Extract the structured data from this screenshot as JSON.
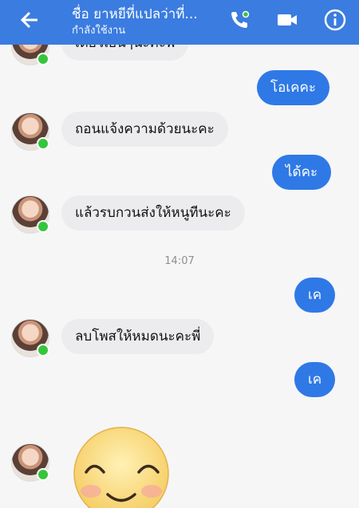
{
  "header": {
    "title": "ชื่อ ยาหยีที่แปลว่าที่...",
    "status": "กำลังใช้งาน",
    "icons": [
      "back-arrow-icon",
      "phone-icon",
      "video-icon",
      "info-icon"
    ]
  },
  "messages": {
    "m0": "เดี๋ยวเย็นๆนะคะพี่",
    "m1": "โอเคคะ",
    "m2": "ถอนแจ้งความด้วยนะคะ",
    "m3": "ได้คะ",
    "m4": "แล้วรบกวนส่งให้หนูทีนะคะ",
    "time": "14:07",
    "m5": "เค",
    "m6": "ลบโพสให้หมดนะคะพี่",
    "m7": "เค"
  },
  "colors": {
    "header": "#3b7ce0",
    "outgoing": "#2f79e6",
    "incoming": "#ececee",
    "online": "#35c53b"
  }
}
